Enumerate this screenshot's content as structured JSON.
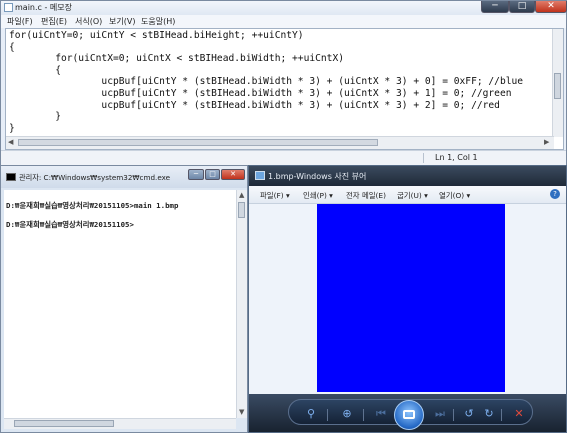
{
  "notepad": {
    "title": "main.c - 메모장",
    "window_buttons": {
      "minimize": "─",
      "maximize": "□",
      "close": "✕"
    },
    "menu": [
      "파일(F)",
      "편집(E)",
      "서식(O)",
      "보기(V)",
      "도움말(H)"
    ],
    "code_lines": [
      "for(uiCntY=0; uiCntY < stBIHead.biHeight; ++uiCntY)",
      "{",
      "        for(uiCntX=0; uiCntX < stBIHead.biWidth; ++uiCntX)",
      "        {",
      "                ucpBuf[uiCntY * (stBIHead.biWidth * 3) + (uiCntX * 3) + 0] = 0xFF; //blue",
      "                ucpBuf[uiCntY * (stBIHead.biWidth * 3) + (uiCntX * 3) + 1] = 0; //green",
      "                ucpBuf[uiCntY * (stBIHead.biWidth * 3) + (uiCntX * 3) + 2] = 0; //red",
      "        }",
      "}"
    ],
    "status": "Ln 1, Col 1"
  },
  "cmd": {
    "title": "관리자: C:₩Windows₩system32₩cmd.exe",
    "window_buttons": {
      "minimize": "─",
      "maximize": "□",
      "close": "✕"
    },
    "lines": [
      "D:₩윤재희₩실습₩영상처리₩20151105>main 1.bmp",
      "D:₩윤재희₩실습₩영상처리₩20151105>"
    ]
  },
  "viewer": {
    "title": "1.bmp-Windows 사진 뷰어",
    "menu": [
      "파일(F) ▾",
      "인쇄(P) ▾",
      "전자 메일(E)",
      "굽기(U) ▾",
      "열기(O) ▾"
    ],
    "help": "?",
    "image_color": "#0000ff",
    "controls": {
      "zoom": "⚲",
      "fit": "⊕",
      "prev": "⏮",
      "next": "⏭",
      "rotate_ccw": "↺",
      "rotate_cw": "↻",
      "delete": "✕"
    }
  },
  "colors": {
    "notepad_frame": "#e7eef8",
    "viewer_bar": "#1f2a38",
    "close_red": "#c0321c",
    "accent_blue": "#2367c4"
  }
}
